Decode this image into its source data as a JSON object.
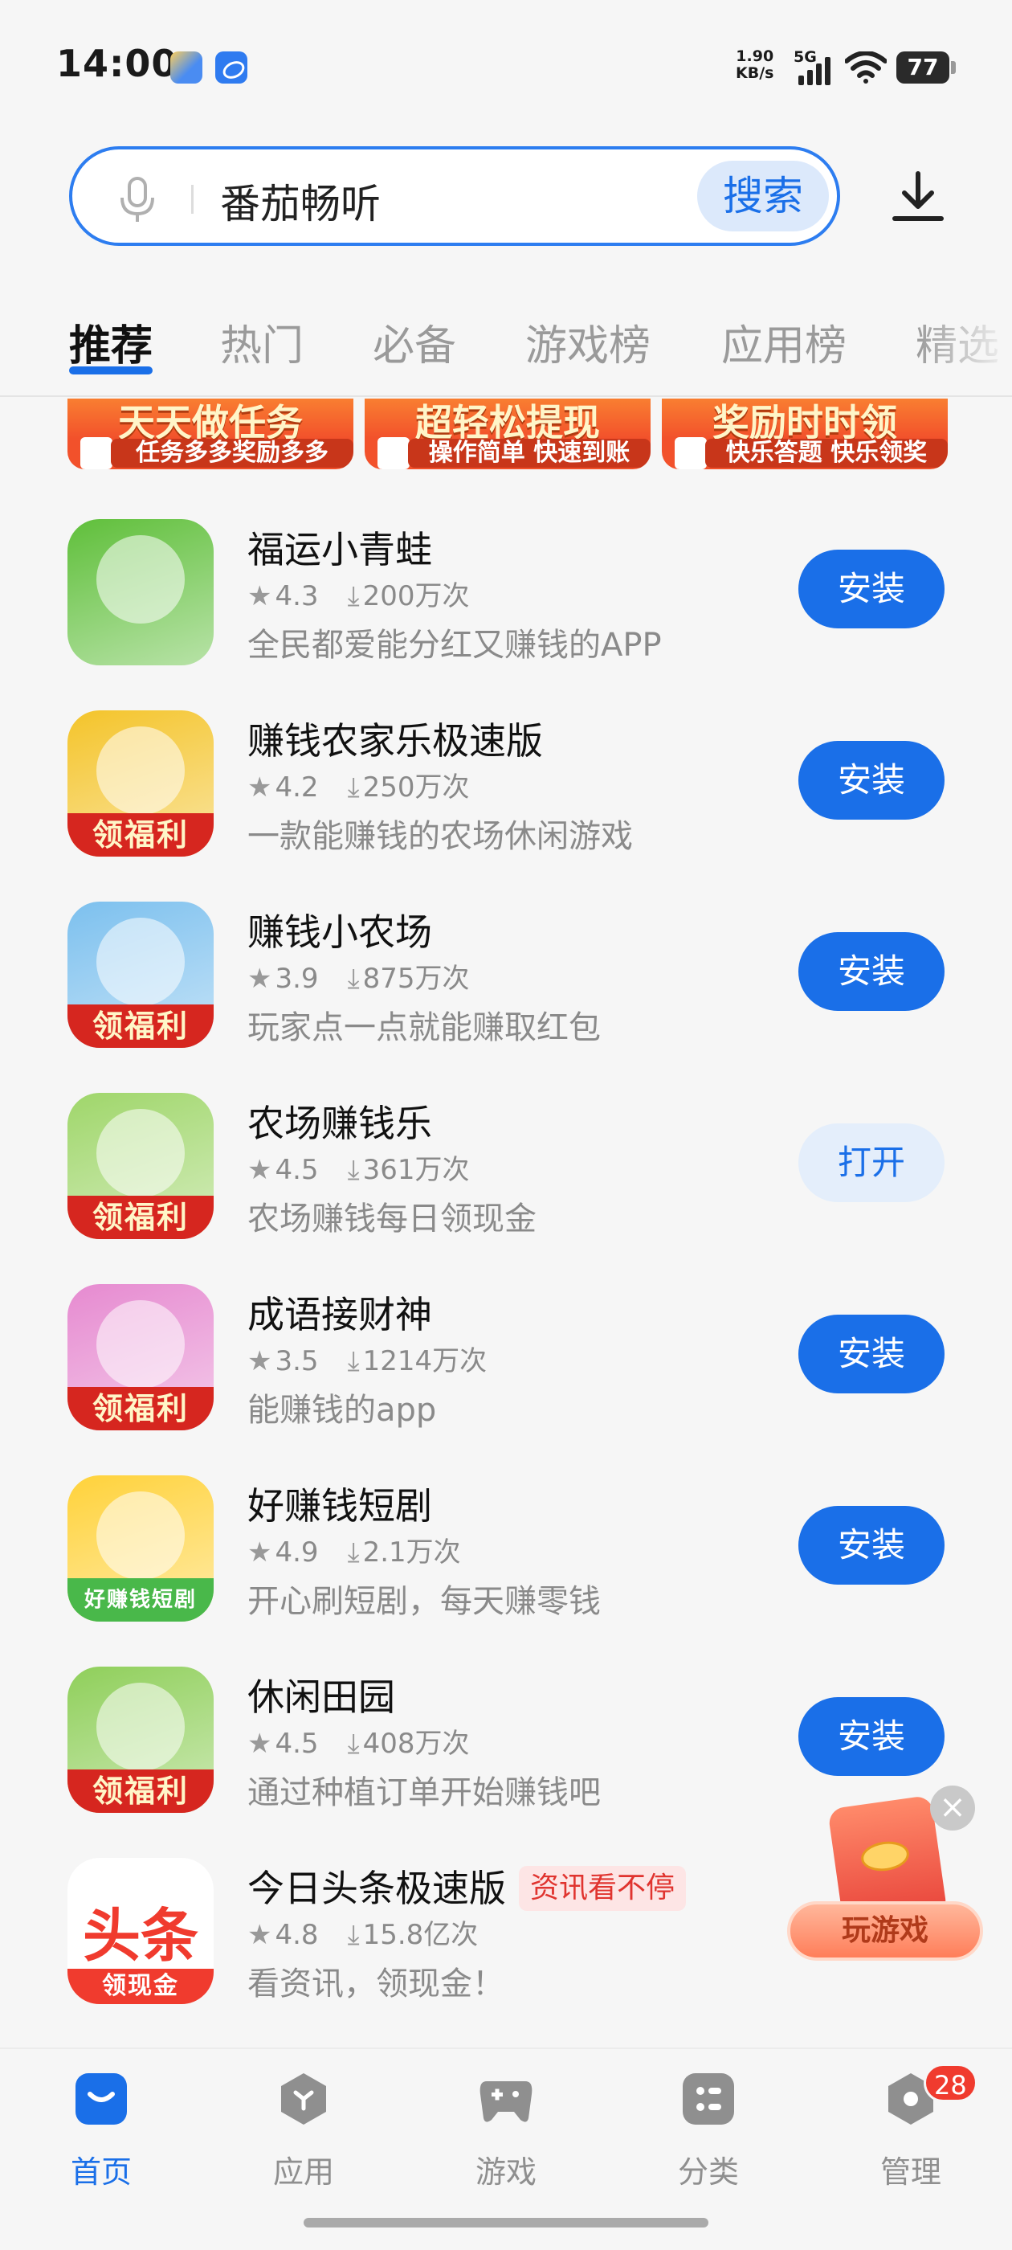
{
  "status_bar": {
    "time": "14:00",
    "net_speed_value": "1.90",
    "net_speed_unit": "KB/s",
    "network": "5G",
    "battery": "77"
  },
  "search": {
    "query": "番茄畅听",
    "button_label": "搜索"
  },
  "tabs": [
    {
      "label": "推荐"
    },
    {
      "label": "热门"
    },
    {
      "label": "必备"
    },
    {
      "label": "游戏榜"
    },
    {
      "label": "应用榜"
    },
    {
      "label": "精选"
    }
  ],
  "banners": [
    {
      "title": "天天做任务",
      "subtitle": "任务多多奖励多多"
    },
    {
      "title": "超轻松提现",
      "subtitle": "操作简单 快速到账"
    },
    {
      "title": "奖励时时领",
      "subtitle": "快乐答题 快乐领奖"
    }
  ],
  "apps": [
    {
      "name": "福运小青蛙",
      "rating": "4.3",
      "downloads": "200万次",
      "desc": "全民都爱能分红又赚钱的APP",
      "button": "安装",
      "ribbon": "",
      "icon": "frog-game-icon",
      "color": "#5fbf3a"
    },
    {
      "name": "赚钱农家乐极速版",
      "rating": "4.2",
      "downloads": "250万次",
      "desc": "一款能赚钱的农场休闲游戏",
      "button": "安装",
      "ribbon": "领福利",
      "icon": "farmer-girl-icon",
      "color": "#f4c42a"
    },
    {
      "name": "赚钱小农场",
      "rating": "3.9",
      "downloads": "875万次",
      "desc": "玩家点一点就能赚取红包",
      "button": "安装",
      "ribbon": "领福利",
      "icon": "cow-icon",
      "color": "#7cc0ee"
    },
    {
      "name": "农场赚钱乐",
      "rating": "4.5",
      "downloads": "361万次",
      "desc": "农场赚钱每日领现金",
      "button": "打开",
      "ribbon": "领福利",
      "icon": "girl-avatar-icon",
      "color": "#9fd66a"
    },
    {
      "name": "成语接财神",
      "rating": "3.5",
      "downloads": "1214万次",
      "desc": "能赚钱的app",
      "button": "安装",
      "ribbon": "领福利",
      "icon": "fortune-god-icon",
      "color": "#e68ad0"
    },
    {
      "name": "好赚钱短剧",
      "rating": "4.9",
      "downloads": "2.1万次",
      "desc": "开心刷短剧，每天赚零钱",
      "button": "安装",
      "ribbon": "好赚钱短剧",
      "icon": "red-envelope-icon",
      "color": "#ffd23a"
    },
    {
      "name": "休闲田园",
      "rating": "4.5",
      "downloads": "408万次",
      "desc": "通过种植订单开始赚钱吧",
      "button": "安装",
      "ribbon": "领福利",
      "icon": "old-farmer-icon",
      "color": "#8fcf5a"
    },
    {
      "name": "今日头条极速版",
      "rating": "4.8",
      "downloads": "15.8亿次",
      "desc": "看资讯，领现金！",
      "button": "",
      "ribbon": "领现金",
      "tag": "资讯看不停",
      "icon_text": "头条",
      "icon": "toutiao-icon",
      "color": "#f03b2e"
    }
  ],
  "float_promo": {
    "label": "玩游戏",
    "close": "×"
  },
  "bottom_nav": [
    {
      "label": "首页",
      "icon": "home-bag-icon"
    },
    {
      "label": "应用",
      "icon": "apps-hex-icon"
    },
    {
      "label": "游戏",
      "icon": "gamepad-icon"
    },
    {
      "label": "分类",
      "icon": "category-grid-icon"
    },
    {
      "label": "管理",
      "icon": "manage-gear-icon",
      "badge": "28"
    }
  ],
  "colors": {
    "accent": "#1a6fe8",
    "accent_light": "#e4eefb",
    "badge_red": "#f03b2e"
  }
}
